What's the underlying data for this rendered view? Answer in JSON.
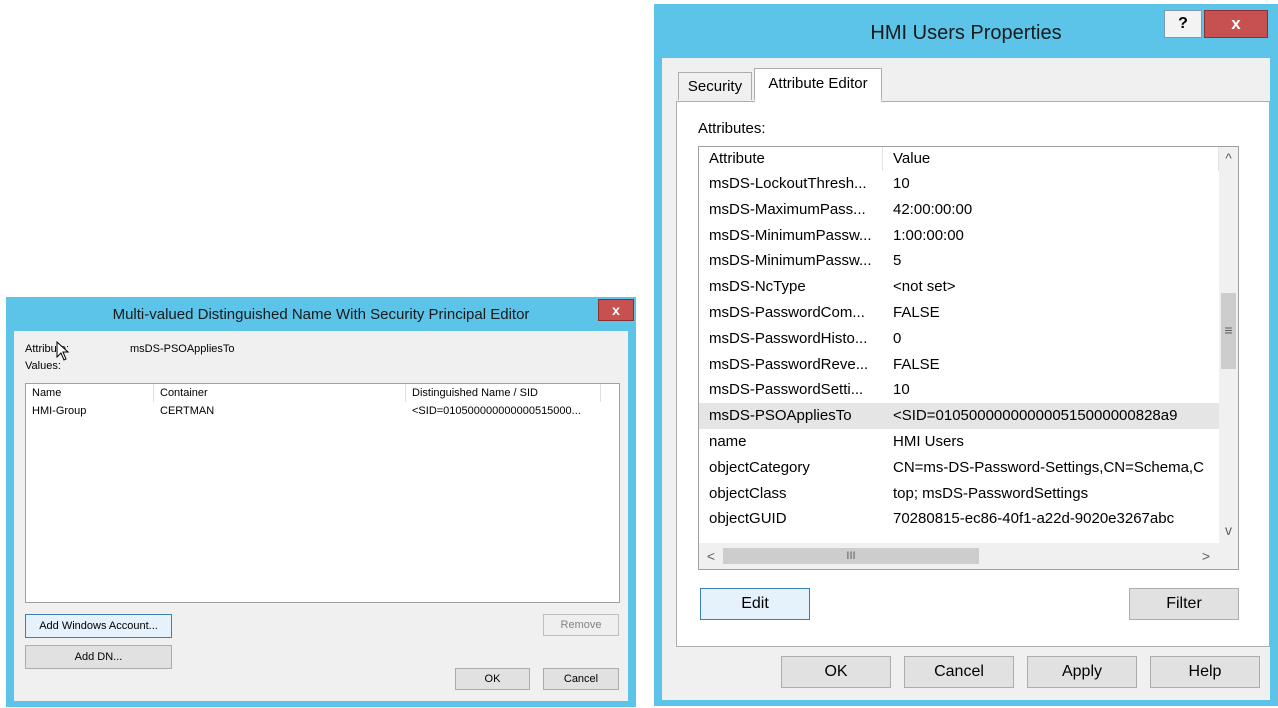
{
  "left_dialog": {
    "title": "Multi-valued Distinguished Name With Security Principal Editor",
    "close": "x",
    "attribute_label": "Attribute:",
    "attribute_value": "msDS-PSOAppliesTo",
    "values_label": "Values:",
    "columns": [
      "Name",
      "Container",
      "Distinguished Name / SID"
    ],
    "rows": [
      {
        "name": "HMI-Group",
        "container": "CERTMAN",
        "dn": "<SID=010500000000000515000..."
      }
    ],
    "buttons": {
      "add_windows_account": "Add Windows Account...",
      "add_dn": "Add DN...",
      "remove": "Remove",
      "ok": "OK",
      "cancel": "Cancel"
    }
  },
  "right_dialog": {
    "title": "HMI Users Properties",
    "help": "?",
    "close": "x",
    "tabs": [
      {
        "label": "Security",
        "active": false
      },
      {
        "label": "Attribute Editor",
        "active": true
      }
    ],
    "attributes_label": "Attributes:",
    "columns": [
      "Attribute",
      "Value"
    ],
    "rows": [
      {
        "attr": "msDS-LockoutThresh...",
        "value": "10"
      },
      {
        "attr": "msDS-MaximumPass...",
        "value": "42:00:00:00"
      },
      {
        "attr": "msDS-MinimumPassw...",
        "value": "1:00:00:00"
      },
      {
        "attr": "msDS-MinimumPassw...",
        "value": "5"
      },
      {
        "attr": "msDS-NcType",
        "value": "<not set>"
      },
      {
        "attr": "msDS-PasswordCom...",
        "value": "FALSE"
      },
      {
        "attr": "msDS-PasswordHisto...",
        "value": "0"
      },
      {
        "attr": "msDS-PasswordReve...",
        "value": "FALSE"
      },
      {
        "attr": "msDS-PasswordSetti...",
        "value": "10"
      },
      {
        "attr": "msDS-PSOAppliesTo",
        "value": "<SID=010500000000000515000000828a9",
        "selected": true
      },
      {
        "attr": "name",
        "value": "HMI Users"
      },
      {
        "attr": "objectCategory",
        "value": "CN=ms-DS-Password-Settings,CN=Schema,C"
      },
      {
        "attr": "objectClass",
        "value": "top; msDS-PasswordSettings"
      },
      {
        "attr": "objectGUID",
        "value": "70280815-ec86-40f1-a22d-9020e3267abc"
      }
    ],
    "scroll": {
      "up": "^",
      "down": "v",
      "left": "<",
      "right": ">",
      "grip_v": "≡",
      "grip_h": "III"
    },
    "buttons": {
      "edit": "Edit",
      "filter": "Filter",
      "ok": "OK",
      "cancel": "Cancel",
      "apply": "Apply",
      "help": "Help"
    }
  }
}
